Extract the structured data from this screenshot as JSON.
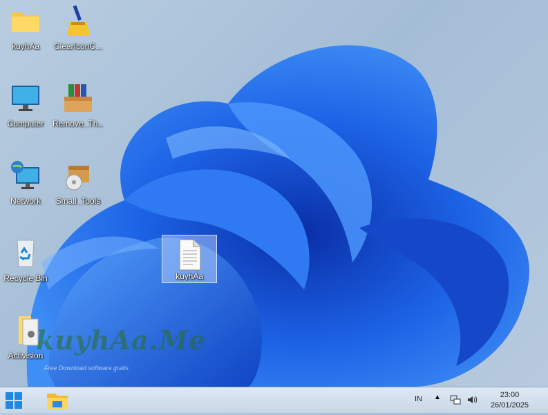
{
  "desktop": {
    "icons": [
      {
        "label": "kuyhAa",
        "icon": "folder-icon"
      },
      {
        "label": "ClearIconC...",
        "icon": "broom-icon"
      },
      {
        "label": "Computer",
        "icon": "monitor-icon"
      },
      {
        "label": "Remove_Th...",
        "icon": "archive-box-icon"
      },
      {
        "label": "Network",
        "icon": "network-globe-icon"
      },
      {
        "label": "Small_Tools",
        "icon": "install-box-icon"
      },
      {
        "label": "Recycle Bin",
        "icon": "recycle-bin-icon"
      },
      {
        "label": "kuyhAa",
        "icon": "text-file-icon",
        "selected": true
      },
      {
        "label": "Activision",
        "icon": "folder-settings-icon"
      }
    ]
  },
  "watermark": {
    "text": "kuyhAa.Me",
    "subtitle": "Free Download software gratis"
  },
  "taskbar": {
    "start_icon": "windows-start-icon",
    "pinned": [
      {
        "icon": "file-explorer-icon"
      }
    ],
    "tray": {
      "language": "IN",
      "icons": [
        "chevron-up-icon",
        "network-icon",
        "volume-icon"
      ],
      "time": "23:00",
      "date": "26/01/2025"
    }
  },
  "colors": {
    "taskbar": "#d3e0ee",
    "wallpaper_blue": "#1a5fe0",
    "wallpaper_bg": "#b3c8dc"
  }
}
